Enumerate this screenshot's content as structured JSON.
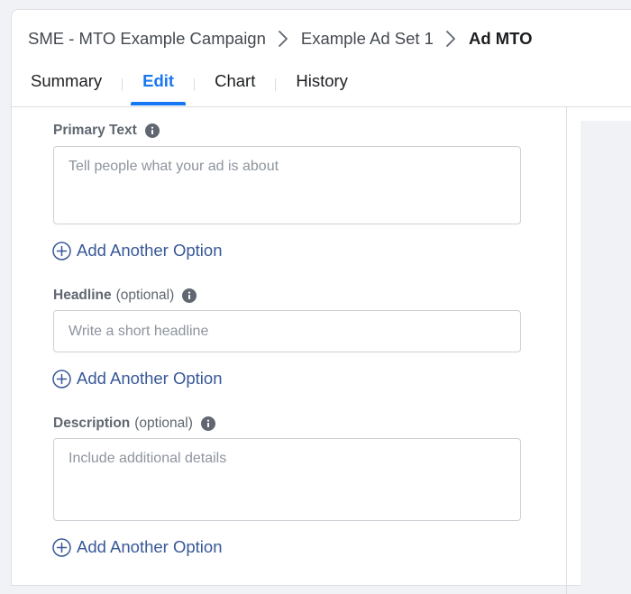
{
  "breadcrumb": {
    "campaign": "SME - MTO Example Campaign",
    "ad_set": "Example Ad Set 1",
    "ad": "Ad MTO"
  },
  "tabs": [
    {
      "label": "Summary"
    },
    {
      "label": "Edit"
    },
    {
      "label": "Chart"
    },
    {
      "label": "History"
    }
  ],
  "active_tab": "Edit",
  "form": {
    "primary_text": {
      "label": "Primary Text",
      "placeholder": "Tell people what your ad is about",
      "value": "",
      "add_option": "Add Another Option"
    },
    "headline": {
      "label": "Headline",
      "optional": "(optional)",
      "placeholder": "Write a short headline",
      "value": "",
      "add_option": "Add Another Option"
    },
    "description": {
      "label": "Description",
      "optional": "(optional)",
      "placeholder": "Include additional details",
      "value": "",
      "add_option": "Add Another Option"
    }
  },
  "icons": {
    "separator": "chevron-right-icon",
    "info": "info-icon",
    "add": "plus-circle-icon"
  },
  "colors": {
    "accent": "#1877f2",
    "link": "#385898",
    "label": "#606770",
    "border": "#ccd0d5"
  }
}
